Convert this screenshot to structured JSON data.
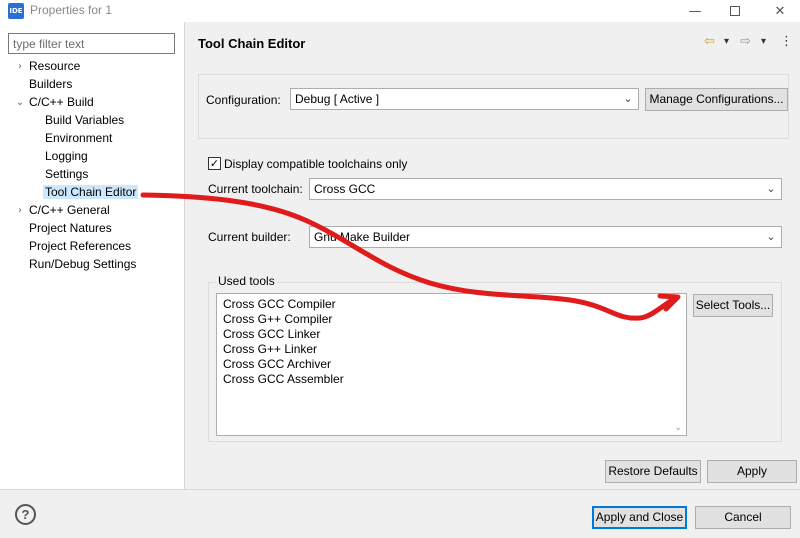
{
  "window": {
    "icon_text": "IDE",
    "title": "Properties for 1",
    "controls": {
      "minimize": "—",
      "close": "✕"
    }
  },
  "sidebar": {
    "filter_placeholder": "type filter text",
    "items": [
      {
        "label": "Resource",
        "arrow": "›"
      },
      {
        "label": "Builders",
        "arrow": ""
      },
      {
        "label": "C/C++ Build",
        "arrow": "⌄"
      },
      {
        "label": "Build Variables",
        "arrow": ""
      },
      {
        "label": "Environment",
        "arrow": ""
      },
      {
        "label": "Logging",
        "arrow": ""
      },
      {
        "label": "Settings",
        "arrow": ""
      },
      {
        "label": "Tool Chain Editor",
        "arrow": "",
        "selected": true
      },
      {
        "label": "C/C++ General",
        "arrow": "›"
      },
      {
        "label": "Project Natures",
        "arrow": ""
      },
      {
        "label": "Project References",
        "arrow": ""
      },
      {
        "label": "Run/Debug Settings",
        "arrow": ""
      }
    ]
  },
  "header": {
    "title": "Tool Chain Editor",
    "nav": {
      "back": "⇦",
      "back_menu": "▾",
      "forward": "⇨",
      "forward_menu": "▾",
      "more": "⋮"
    }
  },
  "configuration": {
    "label": "Configuration:",
    "value": "Debug  [ Active ]",
    "manage_button": "Manage Configurations..."
  },
  "toolchain": {
    "display_compatible_label": "Display compatible toolchains only",
    "display_compatible_checked": "✓",
    "current_toolchain_label": "Current toolchain:",
    "current_toolchain_value": "Cross GCC",
    "current_builder_label": "Current builder:",
    "current_builder_value": "Gnu Make Builder"
  },
  "used_tools": {
    "label": "Used tools",
    "items": [
      "Cross GCC Compiler",
      "Cross G++ Compiler",
      "Cross GCC Linker",
      "Cross G++ Linker",
      "Cross GCC Archiver",
      "Cross GCC Assembler"
    ],
    "select_button": "Select Tools..."
  },
  "actions": {
    "restore_defaults": "Restore Defaults",
    "apply": "Apply",
    "apply_and_close": "Apply and Close",
    "cancel": "Cancel",
    "help": "?"
  },
  "colors": {
    "selection": "#cce8ff",
    "annotation_arrow": "#e01b1b",
    "default_button_border": "#0078d7"
  },
  "icons": {
    "app": "ide-logo-icon",
    "help": "help-icon",
    "back": "back-arrow-icon",
    "forward": "forward-arrow-icon",
    "more": "more-vertical-icon",
    "dropdown": "chevron-down-icon",
    "tree_collapsed": "chevron-right-icon",
    "tree_expanded": "chevron-down-icon"
  }
}
